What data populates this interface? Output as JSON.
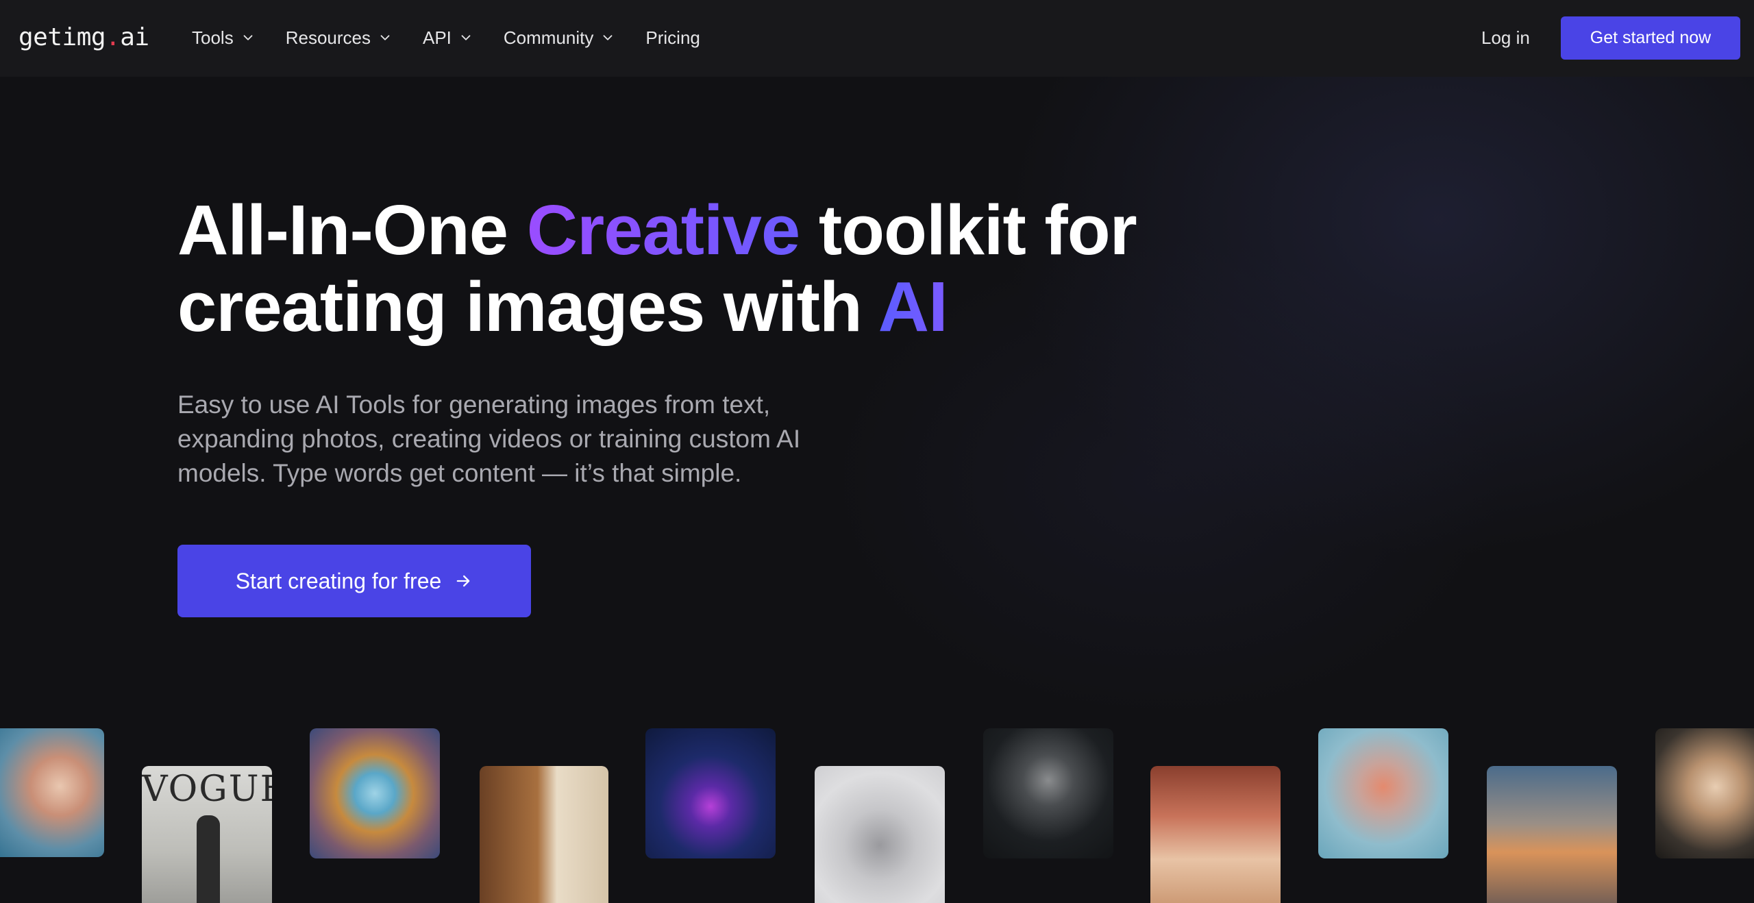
{
  "brand": {
    "logo_prefix": "getimg",
    "logo_dot": ".",
    "logo_suffix": "ai"
  },
  "nav": {
    "items": [
      {
        "label": "Tools",
        "has_dropdown": true
      },
      {
        "label": "Resources",
        "has_dropdown": true
      },
      {
        "label": "API",
        "has_dropdown": true
      },
      {
        "label": "Community",
        "has_dropdown": true
      },
      {
        "label": "Pricing",
        "has_dropdown": false
      }
    ],
    "login_label": "Log in",
    "cta_label": "Get started now"
  },
  "hero": {
    "title_part1": "All-In-One ",
    "title_highlight": "Creative",
    "title_part2": " toolkit for",
    "title_line2": "creating images with ",
    "title_ai": "AI",
    "subtitle_line1": "Easy to use AI Tools for generating images from text,",
    "subtitle_line2": "expanding photos, creating videos or training custom AI",
    "subtitle_line3": "models. Type words get content — it’s that simple.",
    "cta_label": "Start creating for free"
  },
  "colors": {
    "accent": "#4a44e6",
    "background": "#111114",
    "nav_background": "#18181b",
    "logo_dot": "#e23b4f",
    "gradient_start": "#9a4dff",
    "gradient_end": "#6b5bff"
  },
  "gallery": {
    "tile_2_text": "VOGUE"
  }
}
